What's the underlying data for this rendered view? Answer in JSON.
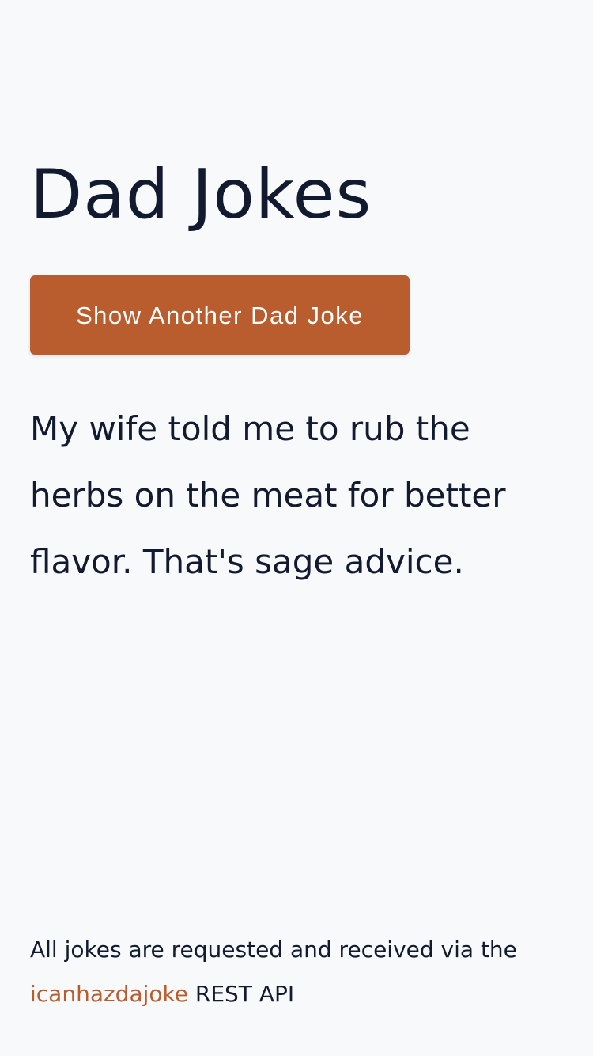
{
  "header": {
    "title": "Dad Jokes"
  },
  "actions": {
    "show_another_label": "Show Another Dad Joke"
  },
  "joke": {
    "text": "My wife told me to rub the herbs on the meat for better flavor. That's sage advice."
  },
  "footer": {
    "text_before_link": "All jokes are requested and received via the",
    "link_text": "icanhazdajoke",
    "text_after_link": "REST API"
  },
  "colors": {
    "accent": "#b95d2e",
    "text": "#111a2e",
    "background": "#f8f9fb"
  }
}
